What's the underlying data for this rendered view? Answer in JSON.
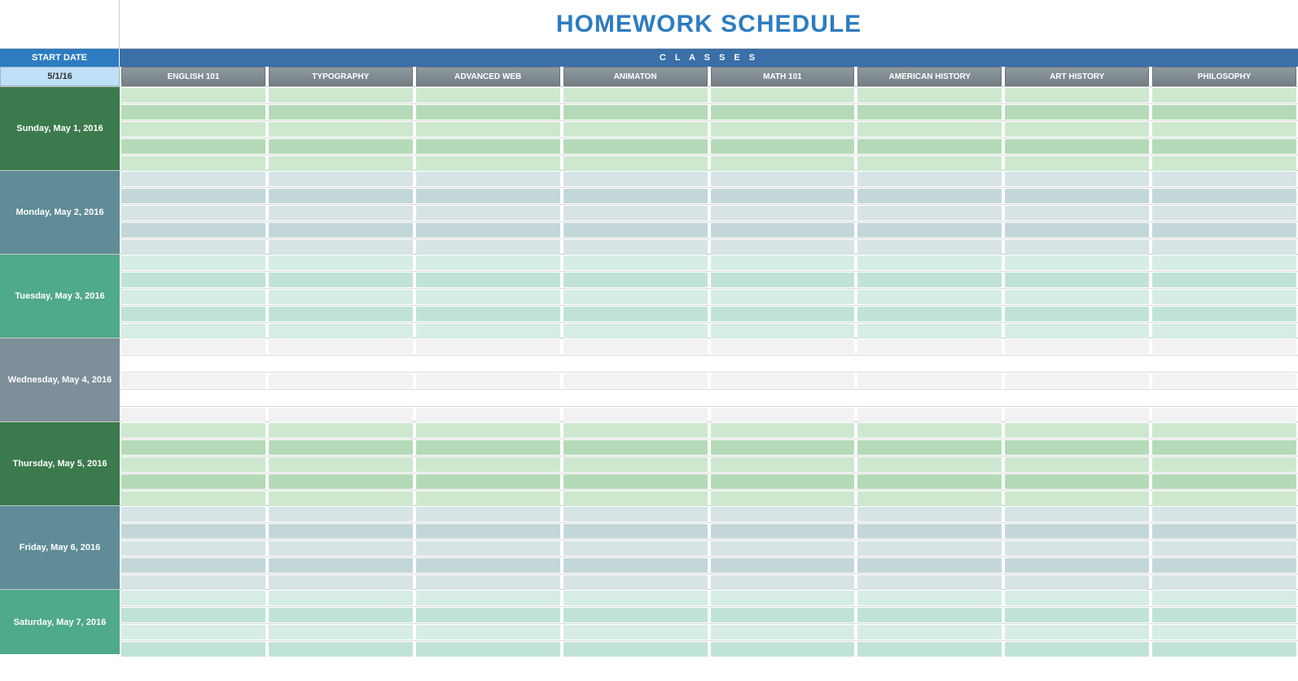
{
  "title": "HOMEWORK SCHEDULE",
  "header": {
    "start_date_label": "START DATE",
    "classes_label": "C L A S S E S",
    "start_date_value": "5/1/16"
  },
  "classes": [
    "ENGLISH 101",
    "TYPOGRAPHY",
    "ADVANCED WEB",
    "ANIMATON",
    "MATH 101",
    "AMERICAN HISTORY",
    "ART HISTORY",
    "PHILOSOPHY"
  ],
  "days": [
    {
      "label": "Sunday, May 1, 2016",
      "palette": 0,
      "rows": 5
    },
    {
      "label": "Monday, May 2, 2016",
      "palette": 1,
      "rows": 5
    },
    {
      "label": "Tuesday, May 3, 2016",
      "palette": 2,
      "rows": 5
    },
    {
      "label": "Wednesday, May 4, 2016",
      "palette": 3,
      "rows": 5
    },
    {
      "label": "Thursday, May 5, 2016",
      "palette": 0,
      "rows": 5
    },
    {
      "label": "Friday, May 6, 2016",
      "palette": 1,
      "rows": 5
    },
    {
      "label": "Saturday, May 7, 2016",
      "palette": 2,
      "rows": 4
    }
  ]
}
